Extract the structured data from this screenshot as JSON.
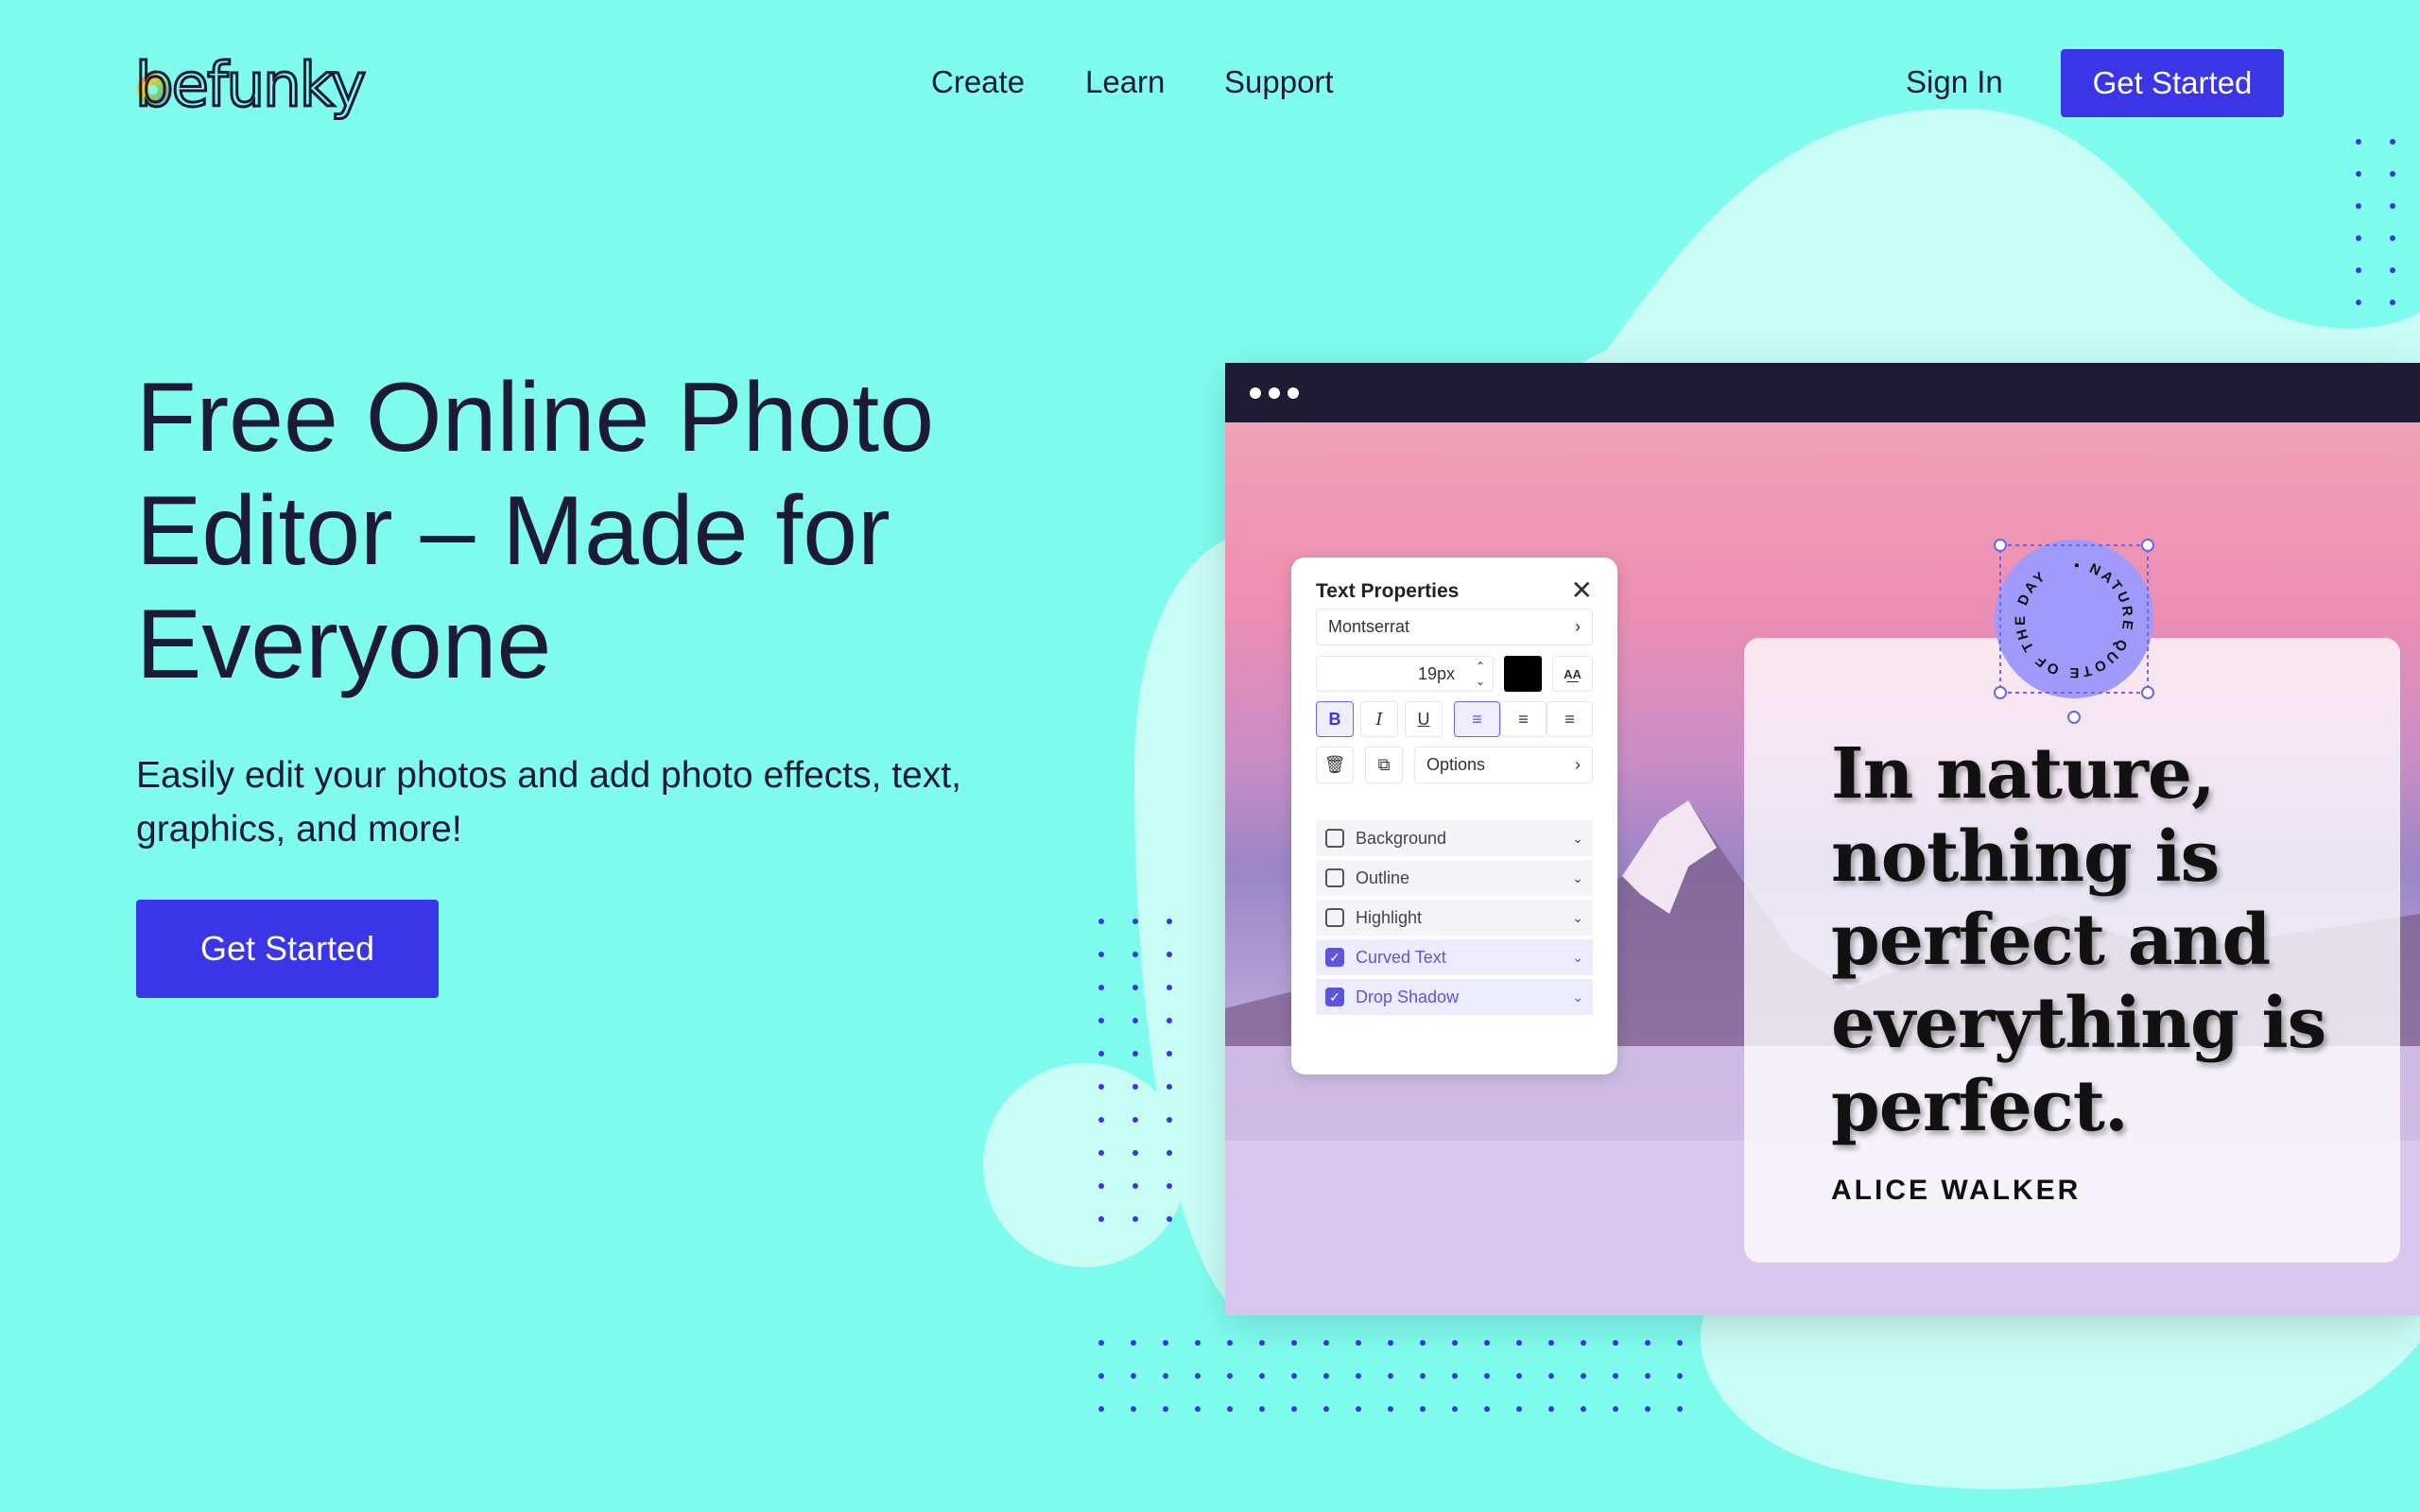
{
  "colors": {
    "background": "#7ffcee",
    "blob": "#c8fdf5",
    "accent": "#3a35e6",
    "dots": "#3a35e6"
  },
  "header": {
    "logo": "befunky",
    "nav": [
      "Create",
      "Learn",
      "Support"
    ],
    "sign_in": "Sign In",
    "cta": "Get Started"
  },
  "hero": {
    "title": "Free Online Photo Editor – Made for Everyone",
    "subtitle": "Easily edit your photos and add photo effects, text, graphics, and more!",
    "cta": "Get Started"
  },
  "editor": {
    "panel": {
      "title": "Text Properties",
      "close_icon": "close-icon",
      "font": "Montserrat",
      "font_size": "19px",
      "text_color": "#000000",
      "options": "Options",
      "style_buttons": [
        {
          "label": "B",
          "active": true
        },
        {
          "label": "I",
          "active": false
        },
        {
          "label": "U",
          "active": false
        }
      ],
      "align": [
        "left",
        "center",
        "right"
      ],
      "align_active": "left",
      "effects": [
        {
          "label": "Background",
          "checked": false
        },
        {
          "label": "Outline",
          "checked": false
        },
        {
          "label": "Highlight",
          "checked": false
        },
        {
          "label": "Curved Text",
          "checked": true
        },
        {
          "label": "Drop Shadow",
          "checked": true
        }
      ]
    },
    "badge_text": "• NATURE QUOTE OF THE DAY ",
    "quote": "In nature, nothing is perfect and everything is perfect.",
    "author": "ALICE WALKER"
  }
}
